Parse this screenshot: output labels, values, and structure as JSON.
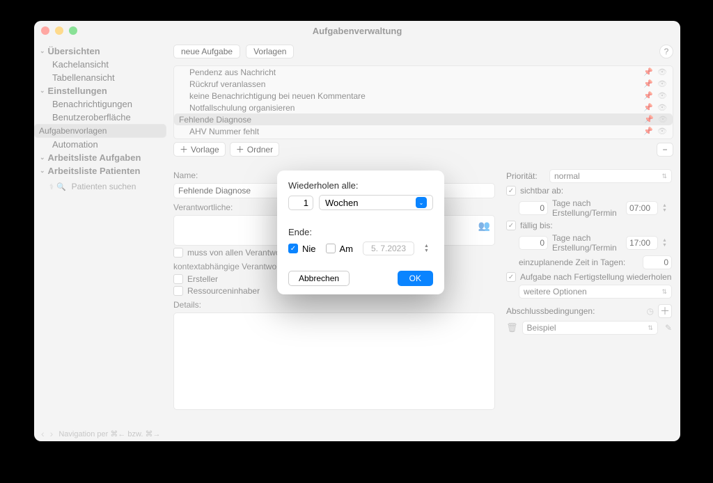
{
  "window": {
    "title": "Aufgabenverwaltung"
  },
  "sidebar": {
    "sections": [
      {
        "label": "Übersichten",
        "items": [
          "Kachelansicht",
          "Tabellenansicht"
        ]
      },
      {
        "label": "Einstellungen",
        "items": [
          "Benachrichtigungen",
          "Benutzeroberfläche",
          "Aufgabenvorlagen",
          "Automation"
        ]
      },
      {
        "label": "Arbeitsliste Aufgaben",
        "items": []
      },
      {
        "label": "Arbeitsliste Patienten",
        "items": []
      }
    ],
    "search_placeholder": "Patienten suchen"
  },
  "toolbar": {
    "new_task": "neue Aufgabe",
    "templates": "Vorlagen"
  },
  "templates": {
    "rows": [
      "Pendenz aus Nachricht",
      "Rückruf veranlassen",
      "keine Benachrichtigung bei neuen Kommentare",
      "Notfallschulung organisieren",
      "Fehlende Diagnose",
      "AHV Nummer fehlt"
    ],
    "add_template": "Vorlage",
    "add_folder": "Ordner"
  },
  "form": {
    "name_label": "Name:",
    "name_value": "Fehlende Diagnose",
    "responsible_label": "Verantwortliche:",
    "must_all": "muss von allen Verantwortlichen erfüllt werden",
    "context_label": "kontextabhängige Verantwortliche:",
    "creator": "Ersteller",
    "owner": "Ressourceninhaber",
    "details_label": "Details:"
  },
  "right": {
    "priority_label": "Priorität:",
    "priority_value": "normal",
    "visible_label": "sichtbar ab:",
    "days_after": "Tage nach Erstellung/Termin",
    "visible_days": "0",
    "visible_time": "07:00",
    "due_label": "fällig bis:",
    "due_days": "0",
    "due_time": "17:00",
    "plan_label": "einzuplanende Zeit in Tagen:",
    "plan_value": "0",
    "repeat_label": "Aufgabe nach Fertigstellung wiederholen",
    "more_options": "weitere Optionen",
    "conditions_label": "Abschlussbedingungen:",
    "condition_example": "Beispiel"
  },
  "nav_hint": "Navigation per ⌘← bzw. ⌘→",
  "modal": {
    "repeat_every": "Wiederholen alle:",
    "interval": "1",
    "unit": "Wochen",
    "end_label": "Ende:",
    "never": "Nie",
    "on": "Am",
    "date": "5. 7.2023",
    "cancel": "Abbrechen",
    "ok": "OK"
  }
}
